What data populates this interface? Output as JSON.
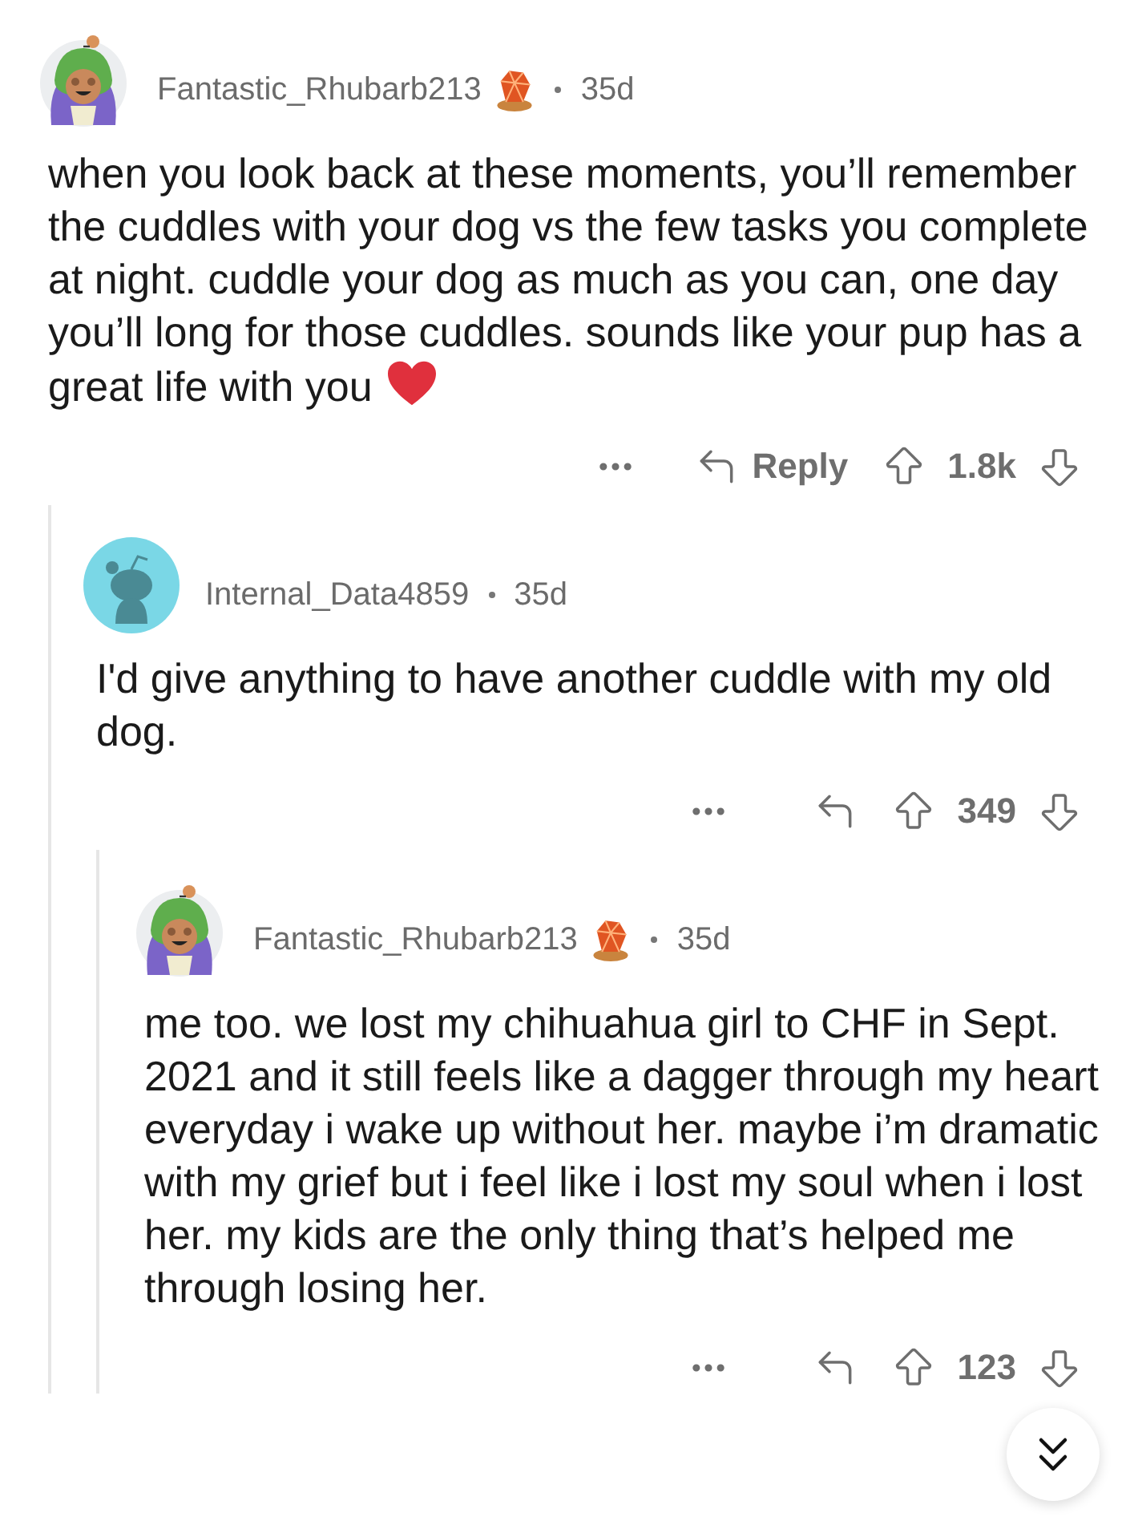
{
  "comments": [
    {
      "author": "Fantastic_Rhubarb213",
      "avatar": {
        "kind": "frog"
      },
      "award": true,
      "time": "35d",
      "body": "when you look back at these moments, you’ll remember the cuddles with your dog vs the few tasks you complete at night. cuddle your dog as much as you can, one day you’ll long for those cuddles. sounds like your pup has a great life with you",
      "emoji": {
        "kind": "heart"
      },
      "reply_label": "Reply",
      "score": "1.8k",
      "children": [
        {
          "author": "Internal_Data4859",
          "avatar": {
            "kind": "snoo"
          },
          "award": false,
          "time": "35d",
          "body": "I'd give anything to have another cuddle with my old dog.",
          "score": "349",
          "children": [
            {
              "author": "Fantastic_Rhubarb213",
              "avatar": {
                "kind": "frog"
              },
              "award": true,
              "time": "35d",
              "body": "me too. we lost my chihuahua girl to CHF in Sept. 2021 and it still feels like a dagger through my heart everyday i wake up without her. maybe i’m dramatic with my grief but i feel like i lost my soul when i lost her. my kids are the only thing that’s helped me through losing her.",
              "score": "123"
            }
          ]
        }
      ]
    }
  ]
}
